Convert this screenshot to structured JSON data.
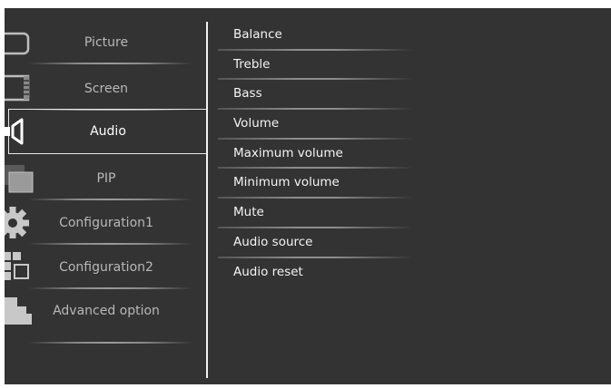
{
  "left_menu": {
    "items": [
      {
        "label": "Picture",
        "icon": "picture-icon",
        "selected": false
      },
      {
        "label": "Screen",
        "icon": "screen-icon",
        "selected": false
      },
      {
        "label": "Audio",
        "icon": "speaker-icon",
        "selected": true
      },
      {
        "label": "PIP",
        "icon": "pip-icon",
        "selected": false
      },
      {
        "label": "Configuration1",
        "icon": "gear-icon",
        "selected": false
      },
      {
        "label": "Configuration2",
        "icon": "configuration-icon",
        "selected": false
      },
      {
        "label": "Advanced option",
        "icon": "advanced-option-icon",
        "selected": false
      }
    ]
  },
  "audio_menu": {
    "items": [
      {
        "label": "Balance"
      },
      {
        "label": "Treble"
      },
      {
        "label": "Bass"
      },
      {
        "label": "Volume"
      },
      {
        "label": "Maximum volume"
      },
      {
        "label": "Minimum volume"
      },
      {
        "label": "Mute"
      },
      {
        "label": "Audio source"
      },
      {
        "label": "Audio reset"
      }
    ]
  },
  "colors": {
    "background": "#333333",
    "highlight_border": "#e8e8e8",
    "text_active": "#ffffff",
    "text_inactive": "#b8b8b8"
  }
}
